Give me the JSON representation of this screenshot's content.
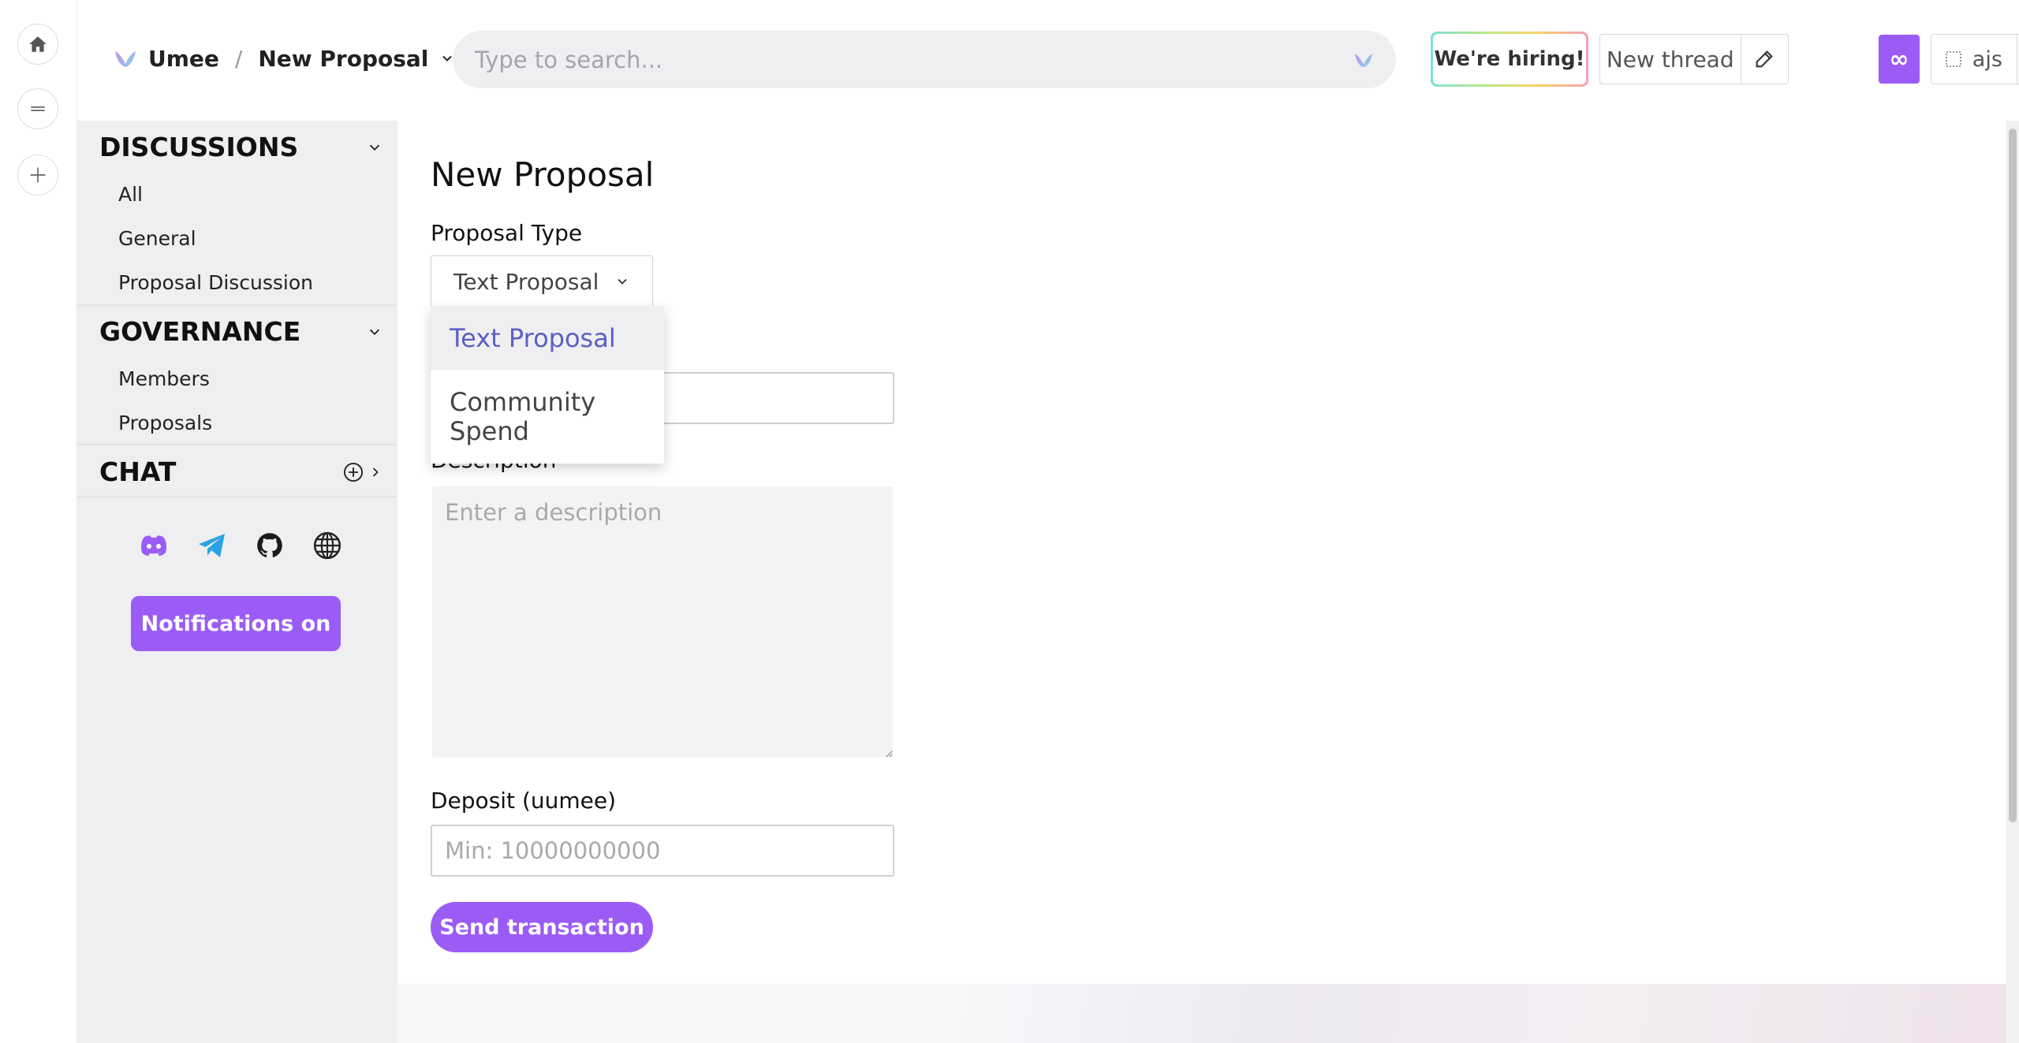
{
  "header": {
    "community": "Umee",
    "separator": "/",
    "page": "New Proposal",
    "search_placeholder": "Type to search...",
    "hiring_label": "We're hiring!",
    "new_thread_label": "New thread",
    "infinity_label": "∞",
    "account_label": "ajs"
  },
  "sidebar": {
    "discussions": {
      "title": "DISCUSSIONS",
      "items": [
        "All",
        "General",
        "Proposal Discussion"
      ]
    },
    "governance": {
      "title": "GOVERNANCE",
      "items": [
        "Members",
        "Proposals"
      ]
    },
    "chat": {
      "title": "CHAT"
    },
    "notifications_label": "Notifications on"
  },
  "form": {
    "title": "New Proposal",
    "proposal_type_label": "Proposal Type",
    "proposal_type_value": "Text Proposal",
    "dropdown_options": [
      "Text Proposal",
      "Community Spend"
    ],
    "title_value": "",
    "description_label": "Description",
    "description_placeholder": "Enter a description",
    "deposit_label": "Deposit (uumee)",
    "deposit_placeholder": "Min: 10000000000",
    "submit_label": "Send transaction"
  },
  "colors": {
    "accent": "#9b5cf6",
    "dropdown_selected_text": "#5b5fc7",
    "sidebar_bg": "#efeff1"
  }
}
